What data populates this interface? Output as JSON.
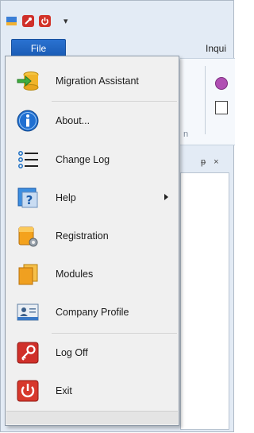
{
  "quick_access": {
    "icons": [
      "app-logo-icon",
      "tool-icon",
      "power-icon"
    ],
    "more_label": "▾"
  },
  "ribbon": {
    "file_tab_label": "File",
    "inquiry_tab_label": "Inqui",
    "group_label_fragment": "n",
    "pane_pin_label": "ᵽ",
    "pane_close_label": "×"
  },
  "file_menu": {
    "items": [
      {
        "label": "Migration Assistant",
        "icon": "migration-arrow-icon"
      },
      {
        "label": "About...",
        "icon": "info-icon"
      },
      {
        "label": "Change Log",
        "icon": "list-icon"
      },
      {
        "label": "Help",
        "icon": "help-icon",
        "has_submenu": true
      },
      {
        "label": "Registration",
        "icon": "registration-icon"
      },
      {
        "label": "Modules",
        "icon": "modules-icon"
      },
      {
        "label": "Company Profile",
        "icon": "company-profile-icon"
      },
      {
        "label": "Log Off",
        "icon": "log-off-key-icon"
      },
      {
        "label": "Exit",
        "icon": "exit-power-icon"
      }
    ]
  },
  "colors": {
    "file_button": "#1a5bb4",
    "menu_bg": "#f0f0f0",
    "info_blue": "#1f6fd1",
    "red_icon": "#d0302a",
    "folder_orange": "#f0a020"
  }
}
